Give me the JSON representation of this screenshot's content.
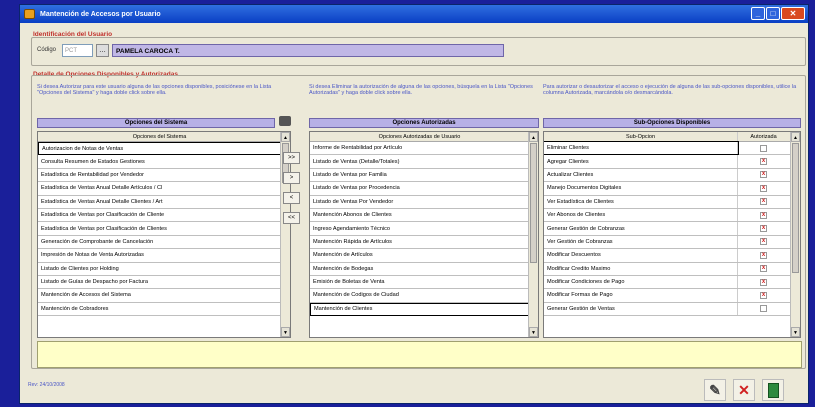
{
  "window": {
    "title": "Mantención de Accesos por Usuario"
  },
  "user_section": {
    "title": "Identificación del Usuario",
    "codigo_label": "Código",
    "codigo_value": "PCT",
    "name_value": "PAMELA CAROCA T."
  },
  "detail_section": {
    "title": "Detalle de Opciones Disponibles y Autorizadas"
  },
  "sistema": {
    "instructions": "Si desea Autorizar para este usuario alguna de las opciones disponibles, posiciónese en la Lista \"Opciones del Sistema\" y haga doble click sobre ella.",
    "header": "Opciones del Sistema",
    "column": "Opciones del Sistema",
    "items": [
      "Autorizacion de Notas de Ventas",
      "Consulta Resumen de Estados Gestiones",
      "Estadística de Rentabilidad por Vendedor",
      "Estadística de Ventas Anual Detalle Artículos / Cl",
      "Estadística de Ventas Anual Detalle Clientes / Art",
      "Estadística de Ventas por Clasificación de Cliente",
      "Estadística de Ventas por Clasificación de Clientes",
      "Generación de Comprobante de Cancelación",
      "Impresión de Notas de Venta Autorizadas",
      "Listado de Clientes por Holding",
      "Listado de Guías de Despacho por Factura",
      "Mantención de Accesos del Sistema",
      "Mantención de Cobradores"
    ]
  },
  "move_buttons": {
    "add_all": ">>",
    "add": ">",
    "remove": "<",
    "remove_all": "<<"
  },
  "autorizadas": {
    "instructions": "Si desea Eliminar la autorización de alguna de las opciones, búsquela en la Lista \"Opciones Autorizadas\" y haga doble click sobre ella.",
    "header": "Opciones Autorizadas",
    "column": "Opciones Autorizadas de Usuario",
    "items": [
      "Informe de Rentabilidad por Artículo",
      "Listado de Ventas (Detalle/Totales)",
      "Listado de Ventas por Familia",
      "Listado de Ventas por Procedencia",
      "Listado de Ventas Por Vendedor",
      "Mantención Abonos de Clientes",
      "Ingreso Agendamiento Técnico",
      "Mantención Rápida de Artículos",
      "Mantención de Artículos",
      "Mantención de Bodegas",
      "Emisión de Boletas de Venta",
      "Mantención de Codigos de Ciudad",
      "Mantención de Clientes"
    ]
  },
  "subopciones": {
    "instructions": "Para autorizar o desautorizar el acceso o ejecución de alguna de las sub-opciones disponibles, utilice la columna Autorizada, marcándola o/o desmarcándola.",
    "header": "Sub-Opciones Disponibles",
    "col_name": "Sub-Opcion",
    "col_auth": "Autorizada",
    "items": [
      {
        "name": "Eliminar Clientes",
        "mark": ""
      },
      {
        "name": "Agregar Clientes",
        "mark": "x"
      },
      {
        "name": "Actualizar Clientes",
        "mark": "x"
      },
      {
        "name": "Manejo Documentos Digitales",
        "mark": "x"
      },
      {
        "name": "Ver Estadística de Clientes",
        "mark": "x"
      },
      {
        "name": "Ver Abonos de Clientes",
        "mark": "x"
      },
      {
        "name": "Generar Gestión de Cobranzas",
        "mark": "x"
      },
      {
        "name": "Ver Gestión de Cobranzas",
        "mark": "x"
      },
      {
        "name": "Modificar Descuentos",
        "mark": "x"
      },
      {
        "name": "Modificar Credito Maximo",
        "mark": "x"
      },
      {
        "name": "Modificar Condiciones de Pago",
        "mark": "x"
      },
      {
        "name": "Modificar Formas de Pago",
        "mark": "x"
      },
      {
        "name": "Generar Gestión de Ventas",
        "mark": ""
      }
    ]
  },
  "footer": {
    "rev": "Rev: 24/10/2008"
  },
  "colors": {
    "desktop": "#1a1f9a",
    "section_title": "#c0302b",
    "instructions": "#4a56c6",
    "panel_header": "#b7b0e6",
    "notes_bg": "#ffffc8",
    "check_mark": "#d02020"
  }
}
